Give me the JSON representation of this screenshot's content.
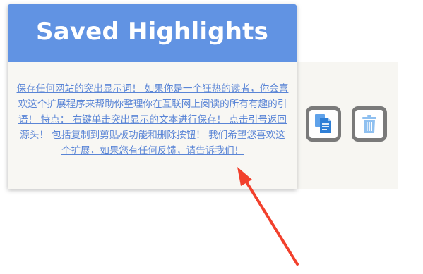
{
  "header": {
    "title": "Saved Highlights"
  },
  "highlight": {
    "text": "保存任何网站的突出显示词！ 如果你是一个狂热的读者，你会喜欢这个扩展程序来帮助你整理你在互联网上阅读的所有有趣的引语！ 特点： 右键单击突出显示的文本进行保存！ 点击引号返回源头！ 包括复制到剪贴板功能和删除按钮！ 我们希望您喜欢这个扩展，如果您有任何反馈，请告诉我们！"
  },
  "actions": {
    "copy_icon": "copy-document-icon",
    "delete_icon": "trash-icon"
  },
  "colors": {
    "header_bg": "#6193e3",
    "link_text": "#5a85d6",
    "icon_blue": "#2f7fd6",
    "icon_frame": "#7a7a7a",
    "arrow_red": "#f2402c"
  }
}
